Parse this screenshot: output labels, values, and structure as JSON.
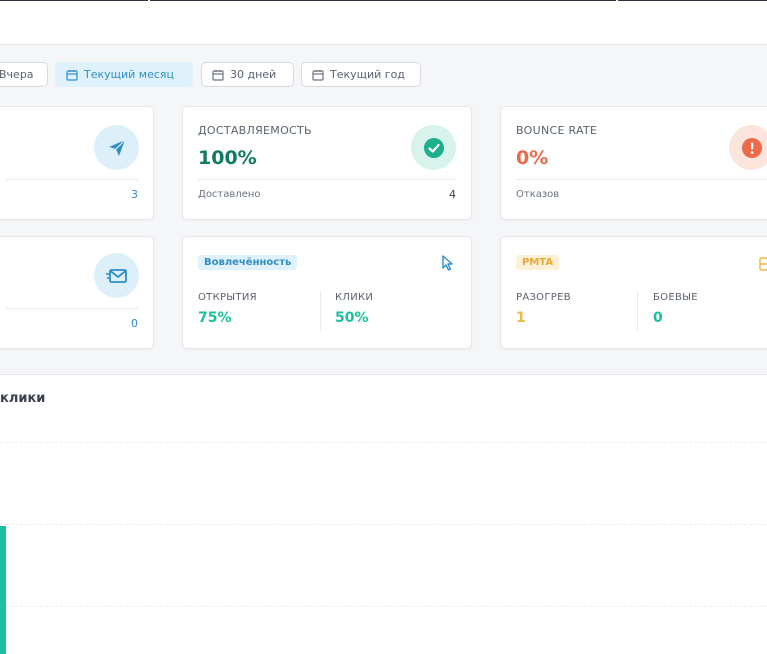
{
  "filters": [
    {
      "label": "Вчера",
      "active": false,
      "icon": "none"
    },
    {
      "label": "Текущий месяц",
      "active": true,
      "icon": "calendar-icon"
    },
    {
      "label": "30 дней",
      "active": false,
      "icon": "calendar-icon"
    },
    {
      "label": "Текущий год",
      "active": false,
      "icon": "calendar-icon"
    }
  ],
  "cards": {
    "sent": {
      "footer_value": "3",
      "icon": "paper-plane-icon",
      "accent": "#2f8fc6"
    },
    "deliverability": {
      "title": "ДОСТАВЛЯЕМОСТЬ",
      "value": "100%",
      "footer_label": "Доставлено",
      "footer_value": "4",
      "icon": "check-circle-icon",
      "accent": "#137a63"
    },
    "bounce": {
      "title": "BOUNCE RATE",
      "value": "0%",
      "footer_label": "Отказов",
      "icon": "alert-circle-icon",
      "accent": "#ea6a4a"
    },
    "mail": {
      "footer_value": "0",
      "icon": "envelope-icon",
      "accent": "#2f8fc6"
    },
    "engagement": {
      "badge": "Вовлечённость",
      "opens_label": "ОТКРЫТИЯ",
      "opens_value": "75%",
      "clicks_label": "КЛИКИ",
      "clicks_value": "50%",
      "icon": "cursor-icon",
      "accent": "#1dbf9e"
    },
    "pmta": {
      "badge": "PMTA",
      "warmup_label": "РАЗОГРЕВ",
      "warmup_value": "1",
      "combat_label": "БОЕВЫЕ",
      "combat_value": "0",
      "icon": "server-icon",
      "accent": "#f0b64a"
    }
  },
  "chart": {
    "title": "клики"
  }
}
